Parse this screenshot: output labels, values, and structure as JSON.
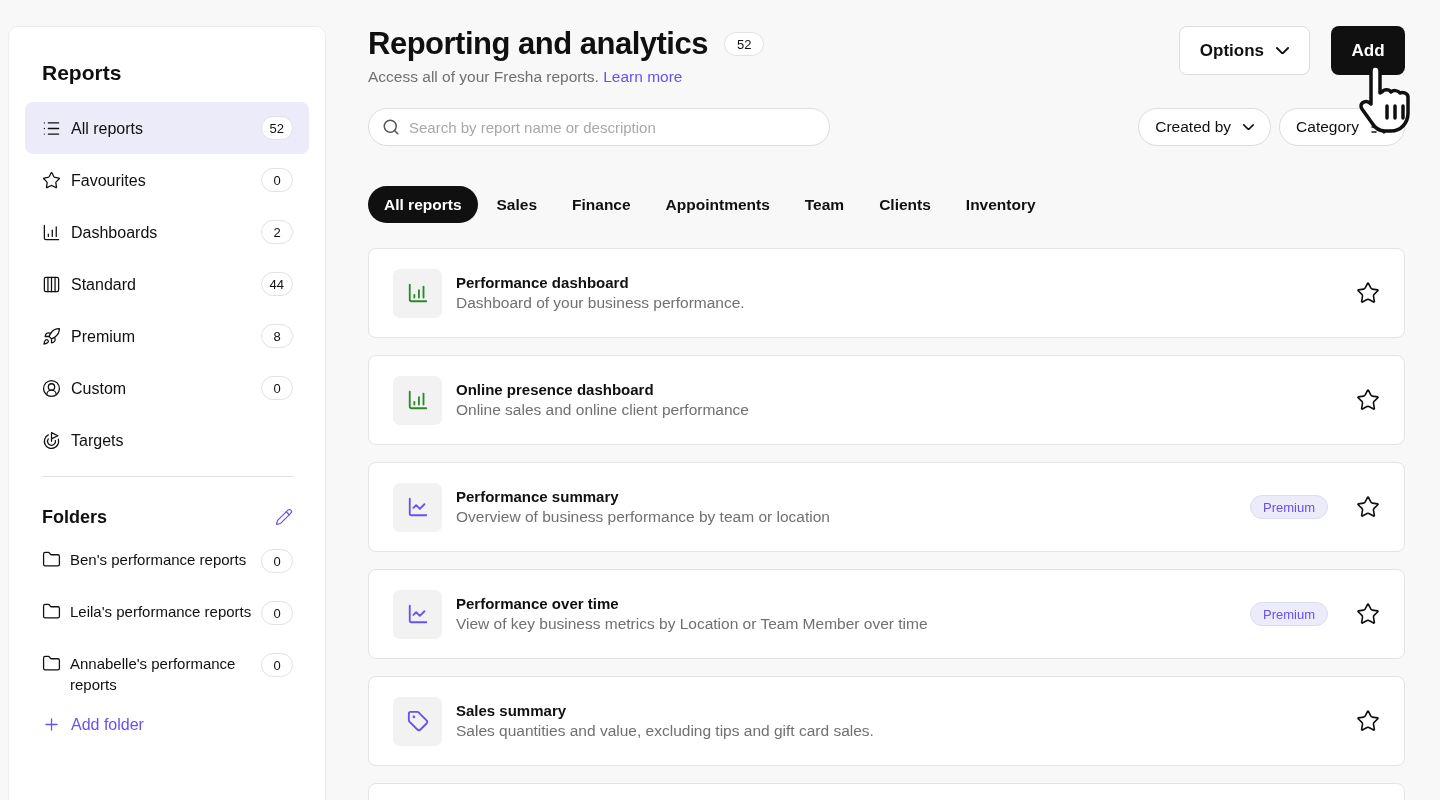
{
  "sidebar": {
    "title": "Reports",
    "items": [
      {
        "label": "All reports",
        "count": "52",
        "selected": true
      },
      {
        "label": "Favourites",
        "count": "0",
        "selected": false
      },
      {
        "label": "Dashboards",
        "count": "2",
        "selected": false
      },
      {
        "label": "Standard",
        "count": "44",
        "selected": false
      },
      {
        "label": "Premium",
        "count": "8",
        "selected": false
      },
      {
        "label": "Custom",
        "count": "0",
        "selected": false
      },
      {
        "label": "Targets",
        "selected": false
      }
    ],
    "folders_title": "Folders",
    "folders": [
      {
        "label": "Ben's performance reports",
        "count": "0"
      },
      {
        "label": "Leila's performance reports",
        "count": "0"
      },
      {
        "label": "Annabelle's performance reports",
        "count": "0"
      }
    ],
    "add_folder": "Add folder"
  },
  "header": {
    "title": "Reporting and analytics",
    "count": "52",
    "subtitle": "Access all of your Fresha reports.",
    "link": "Learn more",
    "options": "Options",
    "add": "Add"
  },
  "search": {
    "placeholder": "Search by report name or description"
  },
  "filters": [
    "Created by",
    "Category"
  ],
  "tabs": [
    {
      "label": "All reports",
      "selected": true
    },
    {
      "label": "Sales",
      "selected": false
    },
    {
      "label": "Finance",
      "selected": false
    },
    {
      "label": "Appointments",
      "selected": false
    },
    {
      "label": "Team",
      "selected": false
    },
    {
      "label": "Clients",
      "selected": false
    },
    {
      "label": "Inventory",
      "selected": false
    }
  ],
  "reports": [
    {
      "kind": "dashboard",
      "title": "Performance dashboard",
      "description": "Dashboard of your business performance."
    },
    {
      "kind": "dashboard",
      "title": "Online presence dashboard",
      "description": "Online sales and online client performance"
    },
    {
      "kind": "trend",
      "title": "Performance summary",
      "description": "Overview of business performance by team or location",
      "badge": "Premium"
    },
    {
      "kind": "trend",
      "title": "Performance over time",
      "description": "View of key business metrics by Location or Team Member over time",
      "badge": "Premium"
    },
    {
      "kind": "tag",
      "title": "Sales summary",
      "description": "Sales quantities and value, excluding tips and gift card sales."
    },
    {
      "kind": "blank"
    }
  ]
}
